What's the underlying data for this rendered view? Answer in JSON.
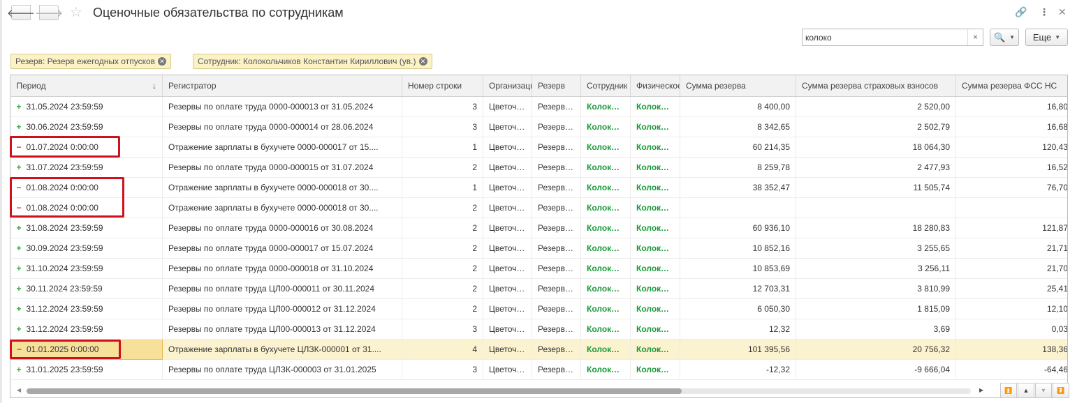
{
  "window": {
    "title": "Оценочные обязательства по сотрудникам",
    "back_icon": "arrow-left-icon",
    "forward_icon": "arrow-right-icon"
  },
  "toolbar": {
    "search_value": "колоко",
    "search_clear": "×",
    "search_icon": "🔍",
    "more_label": "Еще"
  },
  "filters": [
    {
      "label": "Резерв: Резерв ежегодных отпусков"
    },
    {
      "label": "Сотрудник: Колокольчиков Константин Кириллович (ув.)"
    }
  ],
  "table": {
    "columns": [
      "Период",
      "Регистратор",
      "Номер строки",
      "Организация",
      "Резерв",
      "Сотрудник",
      "Физическое лицо",
      "Сумма резерва",
      "Сумма резерва страховых взносов",
      "Сумма резерва ФСС НС"
    ],
    "rows": [
      {
        "sign": "+",
        "period": "31.05.2024 23:59:59",
        "registrar": "Резервы по оплате труда 0000-000013 от 31.05.2024",
        "line": "3",
        "org": "Цветочная",
        "reserve": "Резерв ежегодных отпусков",
        "employee": "Колокольчиков",
        "person": "Колокольчиков",
        "sum": "8 400,00",
        "sum_ins": "2 520,00",
        "sum_fss": "16,80"
      },
      {
        "sign": "+",
        "period": "30.06.2024 23:59:59",
        "registrar": "Резервы по оплате труда 0000-000014 от 28.06.2024",
        "line": "3",
        "org": "Цветочная",
        "reserve": "Резерв ежегодных отпусков",
        "employee": "Колокольчиков",
        "person": "Колокольчиков",
        "sum": "8 342,65",
        "sum_ins": "2 502,79",
        "sum_fss": "16,68"
      },
      {
        "sign": "−",
        "period": "01.07.2024 0:00:00",
        "registrar": "Отражение зарплаты в бухучете 0000-000017 от 15....",
        "line": "1",
        "org": "Цветочная",
        "reserve": "Резерв ежегодных отпусков",
        "employee": "Колокольчиков",
        "person": "Колокольчиков",
        "sum": "60 214,35",
        "sum_ins": "18 064,30",
        "sum_fss": "120,43"
      },
      {
        "sign": "+",
        "period": "31.07.2024 23:59:59",
        "registrar": "Резервы по оплате труда 0000-000015 от 31.07.2024",
        "line": "2",
        "org": "Цветочная",
        "reserve": "Резерв ежегодных отпусков",
        "employee": "Колокольчиков",
        "person": "Колокольчиков",
        "sum": "8 259,78",
        "sum_ins": "2 477,93",
        "sum_fss": "16,52"
      },
      {
        "sign": "−",
        "period": "01.08.2024 0:00:00",
        "registrar": "Отражение зарплаты в бухучете 0000-000018 от 30....",
        "line": "1",
        "org": "Цветочная",
        "reserve": "Резерв ежегодных отпусков",
        "employee": "Колокольчиков",
        "person": "Колокольчиков",
        "sum": "38 352,47",
        "sum_ins": "11 505,74",
        "sum_fss": "76,70"
      },
      {
        "sign": "−",
        "period": "01.08.2024 0:00:00",
        "registrar": "Отражение зарплаты в бухучете 0000-000018 от 30....",
        "line": "2",
        "org": "Цветочная",
        "reserve": "Резерв ежегодных отпусков",
        "employee": "Колокольчиков",
        "person": "Колокольчиков",
        "sum": "",
        "sum_ins": "",
        "sum_fss": ""
      },
      {
        "sign": "+",
        "period": "31.08.2024 23:59:59",
        "registrar": "Резервы по оплате труда 0000-000016 от 30.08.2024",
        "line": "2",
        "org": "Цветочная",
        "reserve": "Резерв ежегодных отпусков",
        "employee": "Колокольчиков",
        "person": "Колокольчиков",
        "sum": "60 936,10",
        "sum_ins": "18 280,83",
        "sum_fss": "121,87"
      },
      {
        "sign": "+",
        "period": "30.09.2024 23:59:59",
        "registrar": "Резервы по оплате труда 0000-000017 от 15.07.2024",
        "line": "2",
        "org": "Цветочная",
        "reserve": "Резерв ежегодных отпусков",
        "employee": "Колокольчиков",
        "person": "Колокольчиков",
        "sum": "10 852,16",
        "sum_ins": "3 255,65",
        "sum_fss": "21,71"
      },
      {
        "sign": "+",
        "period": "31.10.2024 23:59:59",
        "registrar": "Резервы по оплате труда 0000-000018 от 31.10.2024",
        "line": "2",
        "org": "Цветочная",
        "reserve": "Резерв ежегодных отпусков",
        "employee": "Колокольчиков",
        "person": "Колокольчиков",
        "sum": "10 853,69",
        "sum_ins": "3 256,11",
        "sum_fss": "21,70"
      },
      {
        "sign": "+",
        "period": "30.11.2024 23:59:59",
        "registrar": "Резервы по оплате труда ЦЛ00-000011 от 30.11.2024",
        "line": "2",
        "org": "Цветочная",
        "reserve": "Резерв ежегодных отпусков",
        "employee": "Колокольчиков",
        "person": "Колокольчиков",
        "sum": "12 703,31",
        "sum_ins": "3 810,99",
        "sum_fss": "25,41"
      },
      {
        "sign": "+",
        "period": "31.12.2024 23:59:59",
        "registrar": "Резервы по оплате труда ЦЛ00-000012 от 31.12.2024",
        "line": "2",
        "org": "Цветочная",
        "reserve": "Резерв ежегодных отпусков",
        "employee": "Колокольчиков",
        "person": "Колокольчиков",
        "sum": "6 050,30",
        "sum_ins": "1 815,09",
        "sum_fss": "12,10"
      },
      {
        "sign": "+",
        "period": "31.12.2024 23:59:59",
        "registrar": "Резервы по оплате труда ЦЛ00-000013 от 31.12.2024",
        "line": "3",
        "org": "Цветочная",
        "reserve": "Резерв ежегодных отпусков",
        "employee": "Колокольчиков",
        "person": "Колокольчиков",
        "sum": "12,32",
        "sum_ins": "3,69",
        "sum_fss": "0,03"
      },
      {
        "sign": "−",
        "period": "01.01.2025 0:00:00",
        "registrar": "Отражение зарплаты в бухучете ЦЛЗК-000001 от 31....",
        "line": "4",
        "org": "Цветочная",
        "reserve": "Резерв ежегодных отпусков",
        "employee": "Колокольчиков",
        "person": "Колокольчиков",
        "sum": "101 395,56",
        "sum_ins": "20 756,32",
        "sum_fss": "138,36"
      },
      {
        "sign": "+",
        "period": "31.01.2025 23:59:59",
        "registrar": "Резервы по оплате труда ЦЛЗК-000003 от 31.01.2025",
        "line": "3",
        "org": "Цветочная",
        "reserve": "Резерв ежегодных отпусков",
        "employee": "Колокольчиков",
        "person": "Колокольчиков",
        "sum": "-12,32",
        "sum_ins": "-9 666,04",
        "sum_fss": "-64,46"
      }
    ]
  }
}
